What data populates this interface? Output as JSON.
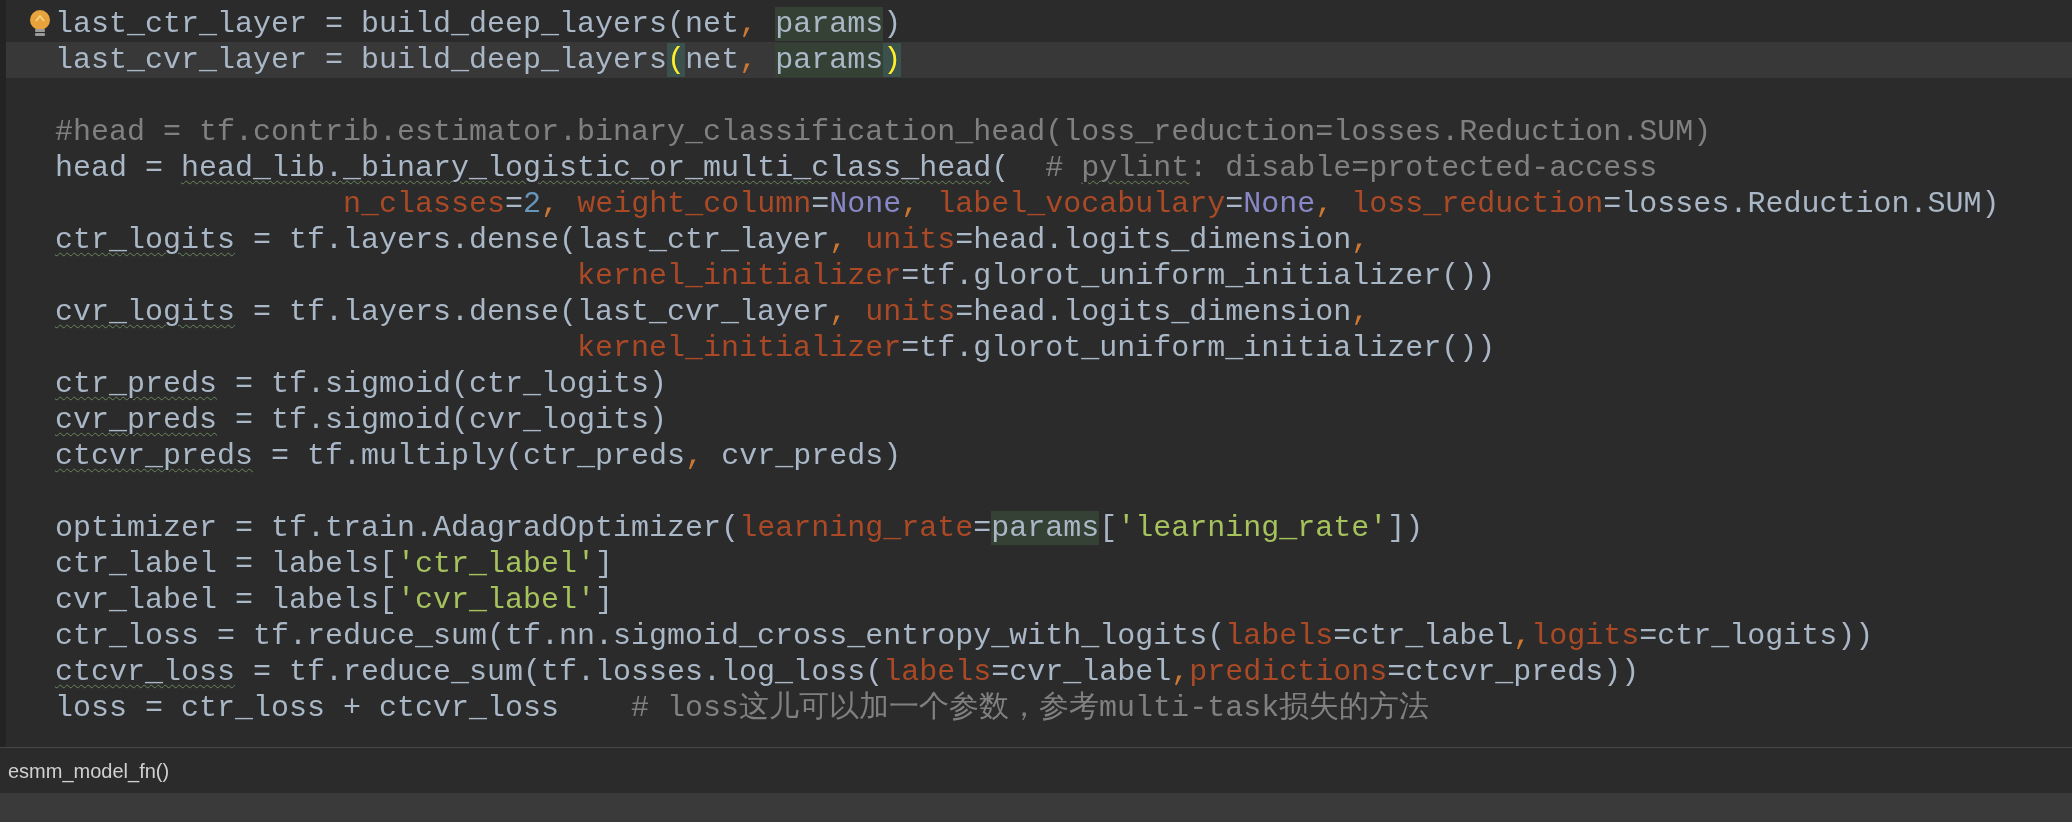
{
  "editor": {
    "lines": [
      {
        "current": false,
        "bulb": true,
        "tokens": [
          {
            "kind": "text",
            "text": "last_ctr_layer = build_deep_layers(net"
          },
          {
            "kind": "comma",
            "text": ", "
          },
          {
            "kind": "usage",
            "text": "params"
          },
          {
            "kind": "text",
            "text": ")"
          }
        ]
      },
      {
        "current": true,
        "bulb": false,
        "tokens": [
          {
            "kind": "text",
            "text": "last_cvr_layer = build_deep_layers"
          },
          {
            "kind": "brace",
            "text": "("
          },
          {
            "kind": "text",
            "text": "net"
          },
          {
            "kind": "comma",
            "text": ", "
          },
          {
            "kind": "usage",
            "text": "params"
          },
          {
            "kind": "brace",
            "text": ")"
          }
        ]
      },
      {
        "current": false,
        "bulb": false
      },
      {
        "current": false,
        "bulb": false,
        "tokens": [
          {
            "kind": "comment",
            "text": "#head = tf.contrib.estimator.binary_classification_head(loss_reduction=losses.Reduction.SUM)"
          }
        ]
      },
      {
        "current": false,
        "bulb": false,
        "tokens": [
          {
            "kind": "text",
            "text": "head = "
          },
          {
            "kind": "typo",
            "text": "head_lib._binary_logistic_or_multi_class_head"
          },
          {
            "kind": "text",
            "text": "(  "
          },
          {
            "kind": "comment",
            "text": "# "
          },
          {
            "kind": "typo_comment",
            "text": "pylint"
          },
          {
            "kind": "comment",
            "text": ": disable=protected-access"
          }
        ]
      },
      {
        "current": false,
        "bulb": false,
        "tokens": [
          {
            "kind": "kwarg",
            "text": "                n_classes"
          },
          {
            "kind": "text",
            "text": "="
          },
          {
            "kind": "number",
            "text": "2"
          },
          {
            "kind": "comma",
            "text": ", "
          },
          {
            "kind": "kwarg",
            "text": "weight_column"
          },
          {
            "kind": "text",
            "text": "="
          },
          {
            "kind": "none",
            "text": "None"
          },
          {
            "kind": "comma",
            "text": ", "
          },
          {
            "kind": "kwarg",
            "text": "label_vocabulary"
          },
          {
            "kind": "text",
            "text": "="
          },
          {
            "kind": "none",
            "text": "None"
          },
          {
            "kind": "comma",
            "text": ", "
          },
          {
            "kind": "kwarg",
            "text": "loss_reduction"
          },
          {
            "kind": "text",
            "text": "=losses.Reduction.SUM)"
          }
        ]
      },
      {
        "current": false,
        "bulb": false,
        "tokens": [
          {
            "kind": "typo",
            "text": "ctr_logits"
          },
          {
            "kind": "text",
            "text": " = tf.layers.dense(last_ctr_layer"
          },
          {
            "kind": "comma",
            "text": ", "
          },
          {
            "kind": "kwarg",
            "text": "units"
          },
          {
            "kind": "text",
            "text": "=head.logits_dimension"
          },
          {
            "kind": "comma",
            "text": ","
          }
        ]
      },
      {
        "current": false,
        "bulb": false,
        "tokens": [
          {
            "kind": "kwarg",
            "text": "                             kernel_initializer"
          },
          {
            "kind": "text",
            "text": "=tf.glorot_uniform_initializer())"
          }
        ]
      },
      {
        "current": false,
        "bulb": false,
        "tokens": [
          {
            "kind": "typo",
            "text": "cvr_logits"
          },
          {
            "kind": "text",
            "text": " = tf.layers.dense(last_cvr_layer"
          },
          {
            "kind": "comma",
            "text": ", "
          },
          {
            "kind": "kwarg",
            "text": "units"
          },
          {
            "kind": "text",
            "text": "=head.logits_dimension"
          },
          {
            "kind": "comma",
            "text": ","
          }
        ]
      },
      {
        "current": false,
        "bulb": false,
        "tokens": [
          {
            "kind": "kwarg",
            "text": "                             kernel_initializer"
          },
          {
            "kind": "text",
            "text": "=tf.glorot_uniform_initializer())"
          }
        ]
      },
      {
        "current": false,
        "bulb": false,
        "tokens": [
          {
            "kind": "typo",
            "text": "ctr_preds"
          },
          {
            "kind": "text",
            "text": " = tf.sigmoid(ctr_logits)"
          }
        ]
      },
      {
        "current": false,
        "bulb": false,
        "tokens": [
          {
            "kind": "typo",
            "text": "cvr_preds"
          },
          {
            "kind": "text",
            "text": " = tf.sigmoid(cvr_logits)"
          }
        ]
      },
      {
        "current": false,
        "bulb": false,
        "tokens": [
          {
            "kind": "typo",
            "text": "ctcvr_preds"
          },
          {
            "kind": "text",
            "text": " = tf.multiply(ctr_preds"
          },
          {
            "kind": "comma",
            "text": ", "
          },
          {
            "kind": "text",
            "text": "cvr_preds)"
          }
        ]
      },
      {
        "current": false,
        "bulb": false
      },
      {
        "current": false,
        "bulb": false,
        "tokens": [
          {
            "kind": "text",
            "text": "optimizer = tf.train.AdagradOptimizer("
          },
          {
            "kind": "kwarg",
            "text": "learning_rate"
          },
          {
            "kind": "text",
            "text": "="
          },
          {
            "kind": "usage",
            "text": "params"
          },
          {
            "kind": "text",
            "text": "["
          },
          {
            "kind": "string",
            "text": "'learning_rate'"
          },
          {
            "kind": "text",
            "text": "])"
          }
        ]
      },
      {
        "current": false,
        "bulb": false,
        "tokens": [
          {
            "kind": "text",
            "text": "ctr_label = labels["
          },
          {
            "kind": "string",
            "text": "'ctr_label'"
          },
          {
            "kind": "text",
            "text": "]"
          }
        ]
      },
      {
        "current": false,
        "bulb": false,
        "tokens": [
          {
            "kind": "text",
            "text": "cvr_label = labels["
          },
          {
            "kind": "string",
            "text": "'cvr_label'"
          },
          {
            "kind": "text",
            "text": "]"
          }
        ]
      },
      {
        "current": false,
        "bulb": false,
        "tokens": [
          {
            "kind": "text",
            "text": "ctr_loss = tf.reduce_sum(tf.nn.sigmoid_cross_entropy_with_logits("
          },
          {
            "kind": "kwarg",
            "text": "labels"
          },
          {
            "kind": "text",
            "text": "=ctr_label"
          },
          {
            "kind": "comma",
            "text": ","
          },
          {
            "kind": "kwarg",
            "text": "logits"
          },
          {
            "kind": "text",
            "text": "=ctr_logits))"
          }
        ]
      },
      {
        "current": false,
        "bulb": false,
        "tokens": [
          {
            "kind": "typo",
            "text": "ctcvr_loss"
          },
          {
            "kind": "text",
            "text": " = tf.reduce_sum(tf.losses.log_loss("
          },
          {
            "kind": "kwarg",
            "text": "labels"
          },
          {
            "kind": "text",
            "text": "=cvr_label"
          },
          {
            "kind": "comma",
            "text": ","
          },
          {
            "kind": "kwarg",
            "text": "predictions"
          },
          {
            "kind": "text",
            "text": "=ctcvr_preds))"
          }
        ]
      },
      {
        "current": false,
        "bulb": false,
        "tokens": [
          {
            "kind": "text",
            "text": "loss = ctr_loss + ctcvr_loss    "
          },
          {
            "kind": "comment",
            "text": "# loss这儿可以加一个参数，参考multi-task损失的方法"
          }
        ]
      }
    ]
  },
  "breadcrumb": "esmm_model_fn()"
}
